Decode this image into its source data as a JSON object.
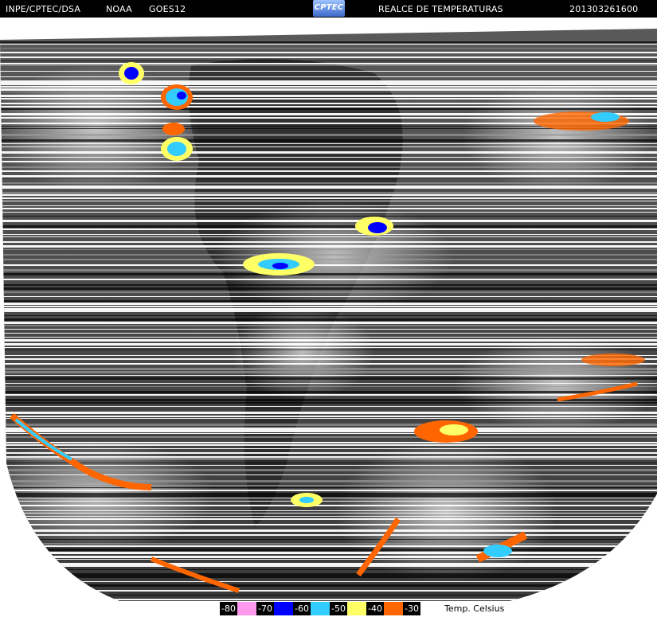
{
  "header": {
    "source": "INPE/CPTEC/DSA",
    "agency": "NOAA",
    "satellite": "GOES12",
    "product": "REALCE DE TEMPERATURAS",
    "timestamp": "201303261600",
    "logo_text": "CPTEC"
  },
  "legend": {
    "title": "Temp. Celsius",
    "items": [
      {
        "label": "-80",
        "color": "#ff99ee"
      },
      {
        "label": "-70",
        "color": "#0000ff"
      },
      {
        "label": "-60",
        "color": "#33ccff"
      },
      {
        "label": "-50",
        "color": "#ffff66"
      },
      {
        "label": "-40",
        "color": "#ff6600"
      },
      {
        "label": "-30",
        "color": null
      }
    ]
  }
}
